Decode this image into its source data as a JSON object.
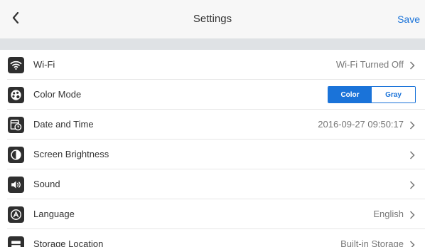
{
  "header": {
    "title": "Settings",
    "save_label": "Save",
    "back_icon": "chevron-left-icon"
  },
  "colors": {
    "accent": "#1a73d9",
    "header_bg": "#f7f7f7",
    "band_bg": "#dfe2e5",
    "icon_bg": "#2f2f2f",
    "value_text": "#777777"
  },
  "settings": {
    "wifi": {
      "label": "Wi-Fi",
      "value": "Wi-Fi Turned Off",
      "icon": "wifi-icon"
    },
    "color_mode": {
      "label": "Color Mode",
      "icon": "palette-icon",
      "options": [
        "Color",
        "Gray"
      ],
      "selected": "Color"
    },
    "date_time": {
      "label": "Date and Time",
      "value": "2016-09-27 09:50:17",
      "icon": "calendar-clock-icon"
    },
    "brightness": {
      "label": "Screen Brightness",
      "value": "",
      "icon": "brightness-icon"
    },
    "sound": {
      "label": "Sound",
      "value": "",
      "icon": "speaker-icon"
    },
    "language": {
      "label": "Language",
      "value": "English",
      "icon": "language-icon"
    },
    "storage": {
      "label": "Storage Location",
      "value": "Built-in Storage",
      "icon": "storage-icon"
    }
  }
}
